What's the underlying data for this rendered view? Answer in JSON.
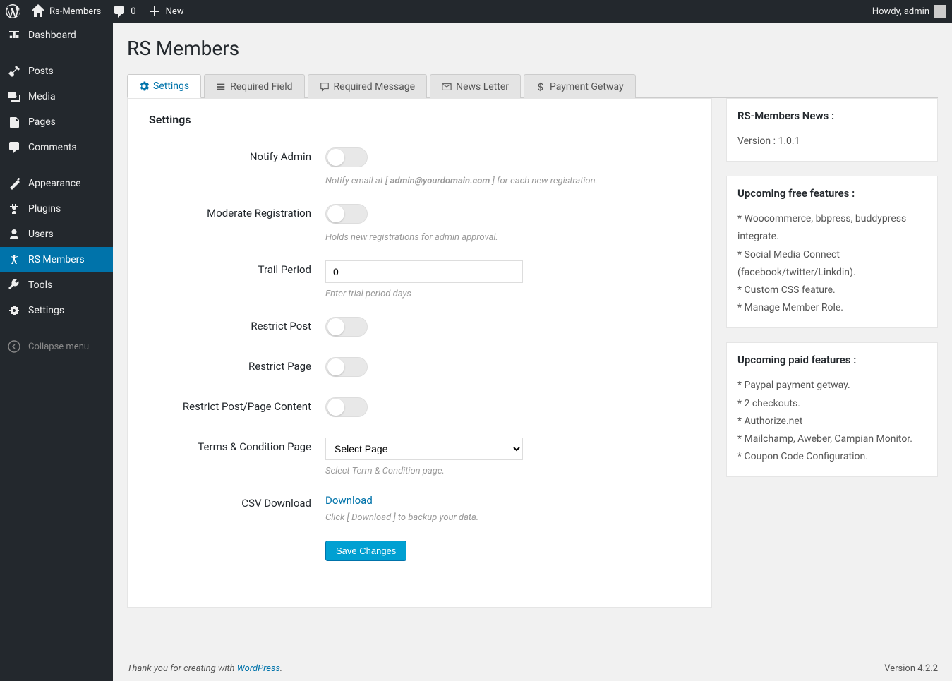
{
  "adminbar": {
    "site_name": "Rs-Members",
    "comments_count": "0",
    "new_label": "New",
    "howdy": "Howdy, admin"
  },
  "sidebar": {
    "items": [
      {
        "label": "Dashboard",
        "icon": "dashboard"
      },
      {
        "label": "Posts",
        "icon": "pin"
      },
      {
        "label": "Media",
        "icon": "media"
      },
      {
        "label": "Pages",
        "icon": "pages"
      },
      {
        "label": "Comments",
        "icon": "comments"
      },
      {
        "label": "Appearance",
        "icon": "appearance"
      },
      {
        "label": "Plugins",
        "icon": "plugins"
      },
      {
        "label": "Users",
        "icon": "users"
      },
      {
        "label": "RS Members",
        "icon": "accessibility"
      },
      {
        "label": "Tools",
        "icon": "tools"
      },
      {
        "label": "Settings",
        "icon": "settings"
      }
    ],
    "collapse_label": "Collapse menu"
  },
  "page": {
    "title": "RS Members"
  },
  "tabs": [
    {
      "label": "Settings",
      "icon": "gear"
    },
    {
      "label": "Required Field",
      "icon": "list"
    },
    {
      "label": "Required Message",
      "icon": "chat"
    },
    {
      "label": "News Letter",
      "icon": "mail"
    },
    {
      "label": "Payment Getway",
      "icon": "dollar"
    }
  ],
  "settings": {
    "section_title": "Settings",
    "notify_admin": {
      "label": "Notify Admin",
      "desc_pre": "Notify email at [ ",
      "desc_email": "admin@yourdomain.com",
      "desc_post": " ] for each new registration."
    },
    "moderate": {
      "label": "Moderate Registration",
      "desc": "Holds new registrations for admin approval."
    },
    "trail": {
      "label": "Trail Period",
      "value": "0",
      "desc": "Enter trial period days"
    },
    "restrict_post": {
      "label": "Restrict Post"
    },
    "restrict_page": {
      "label": "Restrict Page"
    },
    "restrict_content": {
      "label": "Restrict Post/Page Content"
    },
    "terms": {
      "label": "Terms & Condition Page",
      "placeholder": "Select Page",
      "desc": "Select Term & Condition page."
    },
    "csv": {
      "label": "CSV Download",
      "link": "Download",
      "desc": "Click [ Download ] to backup your data."
    },
    "save_button": "Save Changes"
  },
  "news_box": {
    "title": "RS-Members News :",
    "version": "Version : 1.0.1"
  },
  "free_box": {
    "title": "Upcoming free features :",
    "items": [
      "* Woocommerce, bbpress, buddypress integrate.",
      "* Social Media Connect (facebook/twitter/Linkdin).",
      "* Custom CSS feature.",
      "* Manage Member Role."
    ]
  },
  "paid_box": {
    "title": "Upcoming paid features :",
    "items": [
      "* Paypal payment getway.",
      "* 2 checkouts.",
      "* Authorize.net",
      "* Mailchamp, Aweber, Campian Monitor.",
      "* Coupon Code Configuration."
    ]
  },
  "footer": {
    "thanks_pre": "Thank you for creating with ",
    "thanks_link": "WordPress",
    "thanks_post": ".",
    "version": "Version 4.2.2"
  }
}
